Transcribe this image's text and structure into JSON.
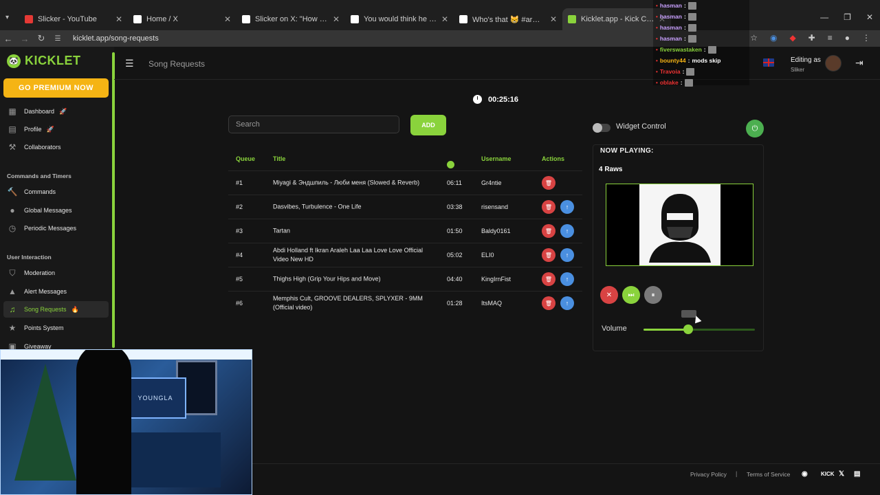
{
  "browser": {
    "tabs": [
      {
        "title": "Slicker - YouTube",
        "icon": "youtube-icon",
        "color": "#e53935"
      },
      {
        "title": "Home / X",
        "icon": "x-logo-icon",
        "color": "#ffffff"
      },
      {
        "title": "Slicker on X: \"How it started vs h",
        "icon": "x-logo-icon",
        "color": "#ffffff"
      },
      {
        "title": "You would think he has learned",
        "icon": "tiktok-icon",
        "color": "#ffffff"
      },
      {
        "title": "Who's that 😸 #armantsarukya",
        "icon": "tiktok-icon",
        "color": "#ffffff"
      },
      {
        "title": "Kicklet.app - Kick Chatbot a",
        "icon": "kicklet-icon",
        "color": "#8ad33c"
      }
    ],
    "url": "kicklet.app/song-requests"
  },
  "sidebar": {
    "logo_mark": "🐼",
    "logo_text": "KICKLET",
    "premium_label": "GO PREMIUM NOW",
    "items_top": [
      {
        "label": "Dashboard",
        "icon": "dashboard-icon",
        "badge": "🚀"
      },
      {
        "label": "Profile",
        "icon": "profile-icon",
        "badge": "🚀"
      },
      {
        "label": "Collaborators",
        "icon": "collaborators-icon",
        "badge": ""
      }
    ],
    "section_commands": "Commands and Timers",
    "items_commands": [
      {
        "label": "Commands",
        "icon": "wrench-icon"
      },
      {
        "label": "Global Messages",
        "icon": "chat-bubble-icon"
      },
      {
        "label": "Periodic Messages",
        "icon": "clock-icon"
      }
    ],
    "section_interaction": "User Interaction",
    "items_interaction": [
      {
        "label": "Moderation",
        "icon": "shield-icon",
        "badge": ""
      },
      {
        "label": "Alert Messages",
        "icon": "warning-icon",
        "badge": ""
      },
      {
        "label": "Song Requests",
        "icon": "music-note-icon",
        "badge": "🔥"
      },
      {
        "label": "Points System",
        "icon": "star-icon",
        "badge": ""
      },
      {
        "label": "Giveaway",
        "icon": "gift-icon",
        "badge": ""
      }
    ]
  },
  "header": {
    "page_title": "Song Requests",
    "editing_label": "Editing as",
    "editing_user": "Sliker"
  },
  "timer": "00:25:16",
  "search": {
    "placeholder": "Search"
  },
  "add_label": "ADD",
  "queue": {
    "headers": {
      "queue": "Queue",
      "title": "Title",
      "duration_icon": "clock-icon",
      "username": "Username",
      "actions": "Actions"
    },
    "rows": [
      {
        "queue": "#1",
        "title": "Miyagi & Эндшпиль - Люби меня (Slowed & Reverb)",
        "duration": "06:11",
        "username": "Gr4ntie",
        "move_up": false
      },
      {
        "queue": "#2",
        "title": "Dasvibes, Turbulence - One Life",
        "duration": "03:38",
        "username": "risensand",
        "move_up": true
      },
      {
        "queue": "#3",
        "title": "Tartan",
        "duration": "01:50",
        "username": "Baldy0161",
        "move_up": true
      },
      {
        "queue": "#4",
        "title": "Abdi Holland ft Ikran Araleh Laa Laa Love Love Official Video New HD",
        "duration": "05:02",
        "username": "ELI0",
        "move_up": true
      },
      {
        "queue": "#5",
        "title": "Thighs High (Grip Your Hips and Move)",
        "duration": "04:40",
        "username": "KingIrnFist",
        "move_up": true
      },
      {
        "queue": "#6",
        "title": "Memphis Cult, GROOVE DEALERS, SPLYXER - 9MM (Official video)",
        "duration": "01:28",
        "username": "ItsMAQ",
        "move_up": true
      }
    ]
  },
  "widget": {
    "label": "Widget Control",
    "enabled": false
  },
  "now_playing": {
    "label": "NOW PLAYING:",
    "song": "4 Raws",
    "volume_label": "Volume",
    "volume_fraction": 0.4
  },
  "footer": {
    "privacy": "Privacy Policy",
    "separator": "|",
    "terms": "Terms of Service",
    "kick_label": "KICK"
  },
  "chat_overlay": [
    {
      "user": "hasman",
      "color": "#c9a0ff",
      "text": ""
    },
    {
      "user": "hasman",
      "color": "#c9a0ff",
      "text": ""
    },
    {
      "user": "hasman",
      "color": "#c9a0ff",
      "text": ""
    },
    {
      "user": "hasman",
      "color": "#c9a0ff",
      "text": ""
    },
    {
      "user": "fiverswastaken",
      "color": "#8ad33c",
      "text": ""
    },
    {
      "user": "bounty44",
      "color": "#f5b414",
      "text": "mods skip"
    },
    {
      "user": "Travoia",
      "color": "#e33",
      "text": ""
    },
    {
      "user": "oblake",
      "color": "#e33",
      "text": ""
    }
  ],
  "webcam": {
    "screen_text": "YOUNGLA"
  }
}
